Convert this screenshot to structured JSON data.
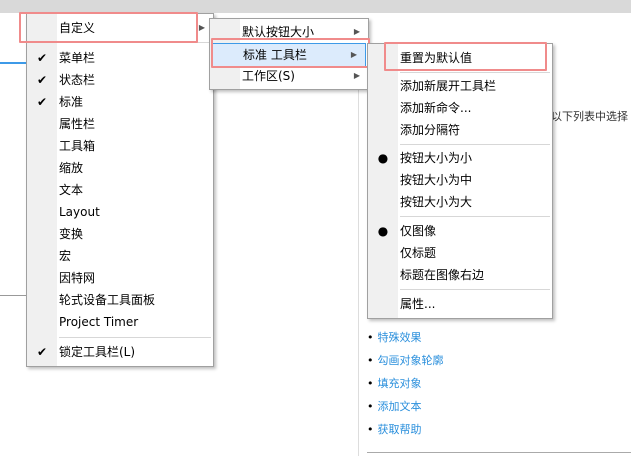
{
  "main_menu": {
    "customize": "自定义",
    "items": [
      {
        "label": "菜单栏",
        "checked": true
      },
      {
        "label": "状态栏",
        "checked": true
      },
      {
        "label": "标准",
        "checked": true
      },
      {
        "label": "属性栏",
        "checked": false
      },
      {
        "label": "工具箱",
        "checked": false
      },
      {
        "label": "缩放",
        "checked": false
      },
      {
        "label": "文本",
        "checked": false
      },
      {
        "label": "Layout",
        "checked": false
      },
      {
        "label": "变换",
        "checked": false
      },
      {
        "label": "宏",
        "checked": false
      },
      {
        "label": "因特网",
        "checked": false
      },
      {
        "label": "轮式设备工具面板",
        "checked": false
      },
      {
        "label": "Project Timer",
        "checked": false
      }
    ],
    "lock": "锁定工具栏(L)"
  },
  "sub_menu": {
    "items": [
      "默认按钮大小",
      "标准 工具栏",
      "工作区(S)"
    ]
  },
  "toolbar_menu": {
    "reset": "重置为默认值",
    "add_items": [
      "添加新展开工具栏",
      "添加新命令...",
      "添加分隔符"
    ],
    "size_items": [
      "按钮大小为小",
      "按钮大小为中",
      "按钮大小为大"
    ],
    "display_items": [
      "仅图像",
      "仅标题",
      "标题在图像右边"
    ],
    "properties": "属性..."
  },
  "panel": {
    "hint": "从以下列表中选择",
    "links": [
      "特殊效果",
      "勾画对象轮廓",
      "填充对象",
      "添加文本",
      "获取帮助"
    ]
  }
}
